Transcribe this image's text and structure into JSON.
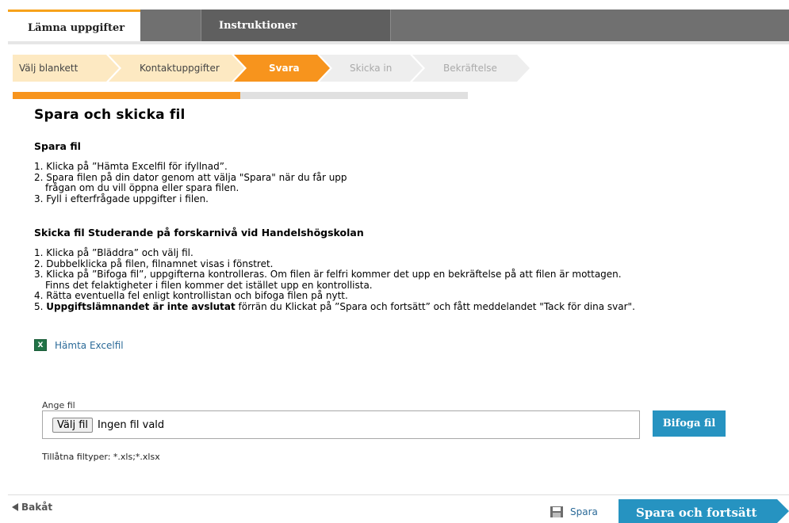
{
  "tabs": {
    "active_label": "Lämna uppgifter",
    "inactive_label": "Instruktioner"
  },
  "steps": [
    {
      "label": "Välj blankett",
      "state": "done"
    },
    {
      "label": "Kontaktuppgifter",
      "state": "done"
    },
    {
      "label": "Svara",
      "state": "current"
    },
    {
      "label": "Skicka in",
      "state": "todo"
    },
    {
      "label": "Bekräftelse",
      "state": "todo"
    }
  ],
  "progress": {
    "fraction": 0.5
  },
  "page": {
    "title": "Spara och skicka fil"
  },
  "save_section": {
    "heading": "Spara fil",
    "items": [
      {
        "text": "1. Klicka på ”Hämta Excelfil för ifyllnad”."
      },
      {
        "text": "2. Spara filen på din dator genom att välja \"Spara\" när du får upp",
        "cont": "frågan om du vill öppna eller spara filen."
      },
      {
        "text": "3. Fyll i efterfrågade uppgifter i filen."
      }
    ]
  },
  "send_section": {
    "heading": "Skicka fil Studerande på forskarnivå vid Handelshögskolan",
    "items": [
      {
        "text": "1. Klicka på ”Bläddra” och välj fil."
      },
      {
        "text": "2. Dubbelklicka på filen, filnamnet visas i fönstret."
      },
      {
        "text": "3. Klicka på ”Bifoga fil”, uppgifterna kontrolleras. Om filen är felfri kommer det upp en bekräftelse på att filen är mottagen.",
        "cont": "Finns det felaktigheter i filen kommer det istället upp en kontrollista."
      },
      {
        "text": "4. Rätta eventuella fel enligt kontrollistan och bifoga filen på nytt."
      }
    ],
    "item5_prefix": "5. ",
    "item5_bold": "Uppgiftslämnandet är inte avslutat",
    "item5_rest": " förrän du Klickat på ”Spara och fortsätt” och fått meddelandet \"Tack för dina svar\"."
  },
  "excel": {
    "icon": "excel-file-icon",
    "icon_glyph": "X",
    "link_label": "Hämta Excelfil"
  },
  "file_upload": {
    "label": "Ange fil",
    "choose_button": "Välj fil",
    "no_file_text": "Ingen fil vald",
    "attach_button": "Bifoga fil",
    "allowed_types": "Tillåtna filtyper: *.xls;*.xlsx"
  },
  "footer": {
    "back_label": "Bakåt",
    "back_icon": "triangle-left-icon",
    "save_label": "Spara",
    "save_icon": "save-disk-icon",
    "save_continue_label": "Spara och fortsätt"
  },
  "colors": {
    "accent": "#f7941d",
    "done_step": "#fde9c2",
    "todo_step": "#eeeeee",
    "button_blue": "#2693c1",
    "link": "#2b6a98"
  }
}
